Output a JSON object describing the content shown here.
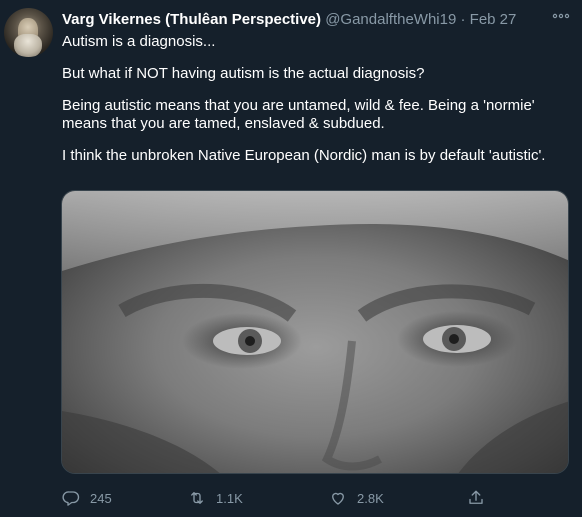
{
  "tweet": {
    "display_name": "Varg Vikernes (Thulêan Perspective)",
    "handle": "@GandalftheWhi19",
    "separator": "·",
    "date": "Feb 27",
    "paragraphs": [
      "Autism is a diagnosis...",
      "But what if NOT having autism is the actual diagnosis?",
      "Being autistic means that you are untamed, wild & fee. Being a 'normie' means that you are tamed, enslaved & subdued.",
      "I think the unbroken Native European (Nordic) man is by default 'autistic'."
    ],
    "media": {
      "description_icon": "photo"
    },
    "actions": {
      "replies": "245",
      "retweets": "1.1K",
      "likes": "2.8K"
    }
  },
  "icons": {
    "more": "more-icon",
    "reply": "reply-icon",
    "retweet": "retweet-icon",
    "like": "heart-icon",
    "share": "share-icon"
  },
  "colors": {
    "background": "#15202b",
    "text": "#ffffff",
    "secondary": "#8899a6",
    "border": "#38444d"
  }
}
